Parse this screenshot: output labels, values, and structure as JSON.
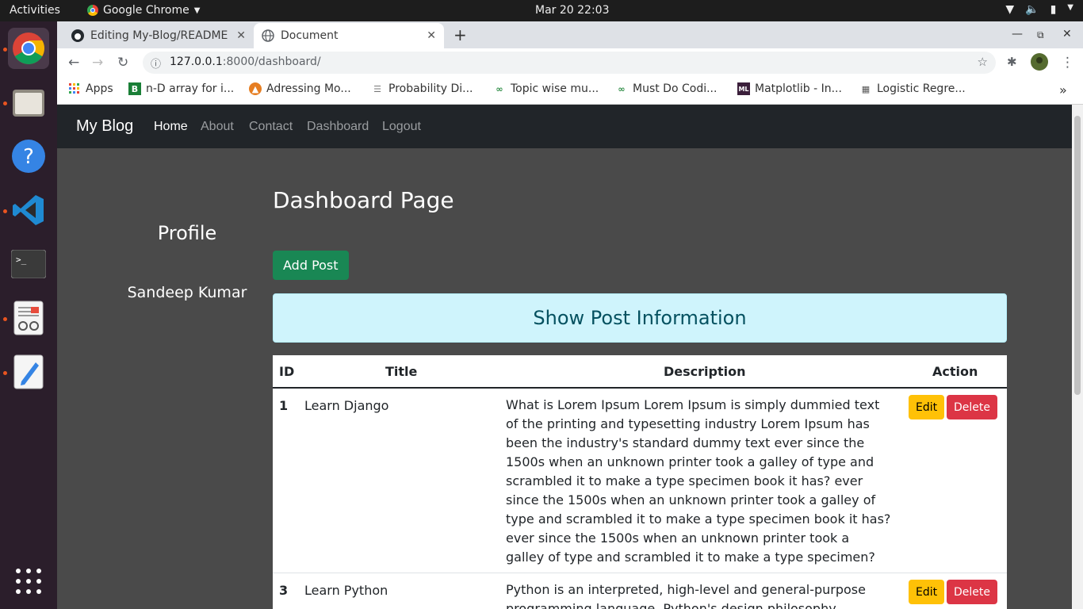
{
  "system_bar": {
    "activities": "Activities",
    "app_name": "Google Chrome",
    "clock": "Mar 20  22:03"
  },
  "browser": {
    "tabs": [
      {
        "title": "Editing My-Blog/README",
        "icon": "github-icon"
      },
      {
        "title": "Document",
        "icon": "globe-icon"
      }
    ],
    "url_host": "127.0.0.1",
    "url_path": ":8000/dashboard/",
    "bookmarks": [
      {
        "label": "Apps"
      },
      {
        "label": "n-D array for i..."
      },
      {
        "label": "Adressing Mo..."
      },
      {
        "label": "Probability Di..."
      },
      {
        "label": "Topic wise mu..."
      },
      {
        "label": "Must Do Codi..."
      },
      {
        "label": "Matplotlib - In..."
      },
      {
        "label": "Logistic Regre..."
      }
    ]
  },
  "site": {
    "brand": "My Blog",
    "nav": [
      "Home",
      "About",
      "Contact",
      "Dashboard",
      "Logout"
    ],
    "profile_title": "Profile",
    "profile_name": "Sandeep Kumar",
    "dashboard_title": "Dashboard Page",
    "add_post": "Add Post",
    "alert": "Show Post Information",
    "table": {
      "headers": [
        "ID",
        "Title",
        "Description",
        "Action"
      ],
      "rows": [
        {
          "id": "1",
          "title": "Learn Django",
          "description": "What is Lorem Ipsum Lorem Ipsum is simply dummied text of the printing and typesetting industry Lorem Ipsum has been the industry's standard dummy text ever since the 1500s when an unknown printer took a galley of type and scrambled it to make a type specimen book it has? ever since the 1500s when an unknown printer took a galley of type and scrambled it to make a type specimen book it has? ever since the 1500s when an unknown printer took a galley of type and scrambled it to make a type specimen?"
        },
        {
          "id": "3",
          "title": "Learn Python",
          "description": "Python is an interpreted, high-level and general-purpose programming language. Python's design philosophy emphasizes"
        }
      ],
      "edit_label": "Edit",
      "delete_label": "Delete"
    }
  }
}
